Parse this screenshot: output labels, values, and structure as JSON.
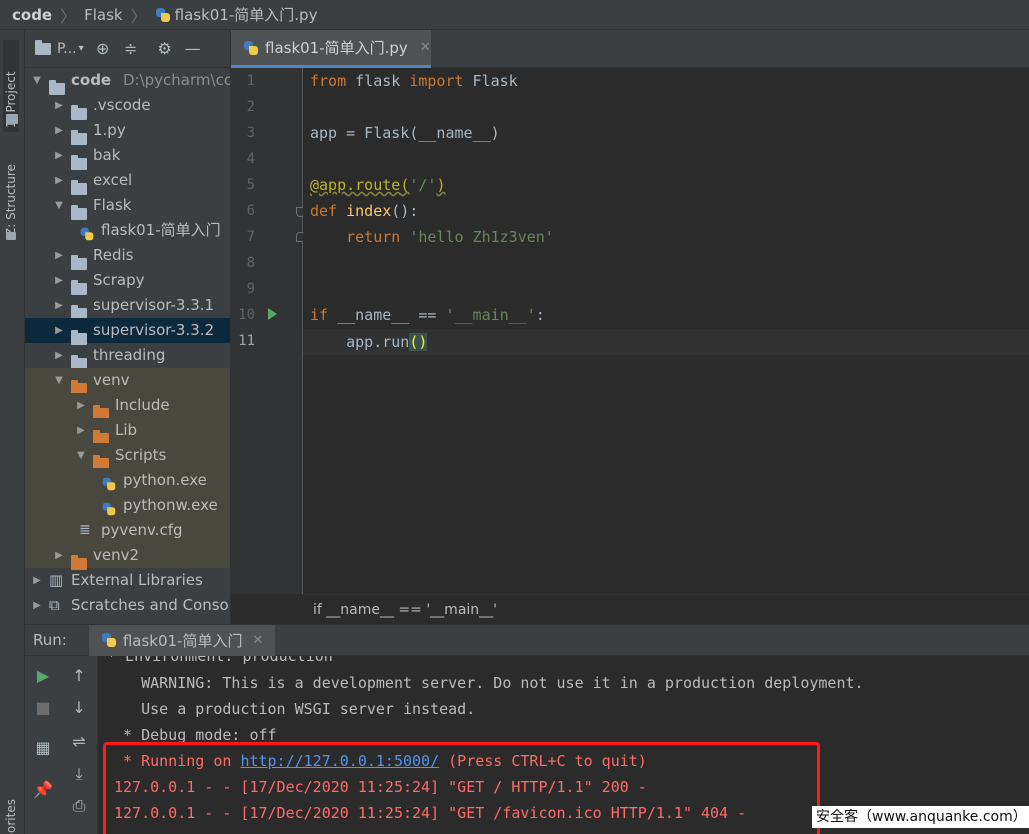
{
  "breadcrumb": {
    "root": "code",
    "folder": "Flask",
    "file": "flask01-简单入门.py"
  },
  "left_strip": {
    "project_tab": "1: Project",
    "structure_tab": "Z: Structure",
    "favorites_tab": "orites"
  },
  "project_panel": {
    "selector_label": "P...",
    "tree": [
      {
        "label": "code",
        "path": "D:\\pycharm\\cod",
        "type": "folder",
        "expanded": true,
        "level": 0
      },
      {
        "label": ".vscode",
        "type": "folder",
        "level": 1
      },
      {
        "label": "1.py",
        "type": "folder",
        "level": 1
      },
      {
        "label": "bak",
        "type": "folder",
        "level": 1
      },
      {
        "label": "excel",
        "type": "folder",
        "level": 1
      },
      {
        "label": "Flask",
        "type": "folder",
        "expanded": true,
        "level": 1
      },
      {
        "label": "flask01-简单入门",
        "type": "python-file",
        "level": 2
      },
      {
        "label": "Redis",
        "type": "folder",
        "level": 1
      },
      {
        "label": "Scrapy",
        "type": "folder",
        "level": 1
      },
      {
        "label": "supervisor-3.3.1",
        "type": "folder",
        "level": 1
      },
      {
        "label": "supervisor-3.3.2",
        "type": "folder",
        "level": 1,
        "selected": true
      },
      {
        "label": "threading",
        "type": "folder",
        "level": 1
      },
      {
        "label": "venv",
        "type": "folder-orange",
        "expanded": true,
        "level": 1
      },
      {
        "label": "Include",
        "type": "folder-orange",
        "level": 2
      },
      {
        "label": "Lib",
        "type": "folder-orange",
        "level": 2
      },
      {
        "label": "Scripts",
        "type": "folder-orange",
        "expanded": true,
        "level": 2
      },
      {
        "label": "python.exe",
        "type": "python-file",
        "level": 3
      },
      {
        "label": "pythonw.exe",
        "type": "python-file",
        "level": 3
      },
      {
        "label": "pyvenv.cfg",
        "type": "text-file",
        "level": 2
      },
      {
        "label": "venv2",
        "type": "folder-orange",
        "level": 1
      },
      {
        "label": "External Libraries",
        "type": "library",
        "level": 0
      },
      {
        "label": "Scratches and Consol",
        "type": "scratch",
        "level": 0
      }
    ]
  },
  "editor": {
    "tab_label": "flask01-简单入门.py",
    "line_numbers": [
      "1",
      "2",
      "3",
      "4",
      "5",
      "6",
      "7",
      "8",
      "9",
      "10",
      "11"
    ],
    "code": {
      "l1_kw1": "from",
      "l1_mid": " flask ",
      "l1_kw2": "import",
      "l1_end": " Flask",
      "l3": "app = Flask(__name__)",
      "l5_deco": "@app.route",
      "l5_open": "(",
      "l5_str": "'/'",
      "l5_close": ")",
      "l6_kw": "def",
      "l6_fn": "index",
      "l6_end": "():",
      "l7_kw": "return",
      "l7_str": "'hello Zh1z3ven'",
      "l10_kw": "if",
      "l10_mid": " __name__ == ",
      "l10_str": "'__main__'",
      "l10_end": ":",
      "l11_start": "app.run",
      "l11_paren": "()"
    },
    "breadcrumb": "if __name__ == '__main__'"
  },
  "run_panel": {
    "label": "Run:",
    "tab_label": "flask01-简单入门",
    "console": {
      "line0": " * Environment: production",
      "line1": "   WARNING: This is a development server. Do not use it in a production deployment.",
      "line2": "   Use a production WSGI server instead.",
      "line3": " * Debug mode: off",
      "line4_pre": " * Running on ",
      "line4_link": "http://127.0.0.1:5000/",
      "line4_post": " (Press CTRL+C to quit)",
      "line5": "127.0.0.1 - - [17/Dec/2020 11:25:24] \"GET / HTTP/1.1\" 200 -",
      "line6": "127.0.0.1 - - [17/Dec/2020 11:25:24] \"GET /favicon.ico HTTP/1.1\" 404 -"
    }
  },
  "watermark": "安全客（www.anquanke.com）",
  "colors": {
    "keyword": "#cc7832",
    "function": "#ffc66d",
    "string": "#6a8759",
    "decorator": "#bbb529",
    "error": "#ff6b68",
    "link": "#5394ec",
    "selection": "#0d293e",
    "highlight_box": "#ff1a1a"
  }
}
